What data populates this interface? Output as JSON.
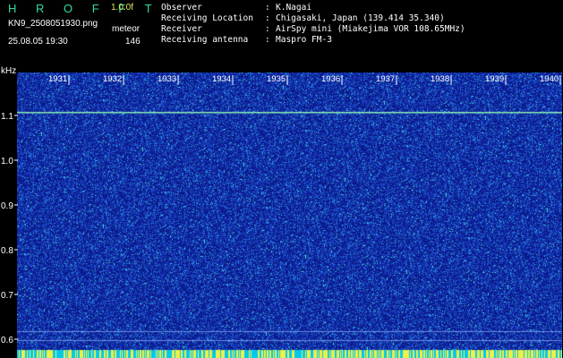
{
  "header": {
    "app_name": "H R O F F T",
    "version": "1.0.0f",
    "filename": "KN9_2508051930.png",
    "meteor_label": "meteor",
    "datetime": "25.08.05 19:30",
    "meteor_count": "146"
  },
  "info": [
    {
      "key": "Observer",
      "sep": ":",
      "value": "K.Nagai"
    },
    {
      "key": "Receiving Location",
      "sep": ":",
      "value": "Chigasaki, Japan (139.414 35.340)"
    },
    {
      "key": "Receiver",
      "sep": ":",
      "value": "AirSpy mini (Miakejima VOR 108.65MHz)"
    },
    {
      "key": "Receiving antenna",
      "sep": ":",
      "value": "Maspro FM-3"
    }
  ],
  "spectrogram": {
    "y_unit": "kHz",
    "y_ticks": [
      "1.1",
      "1.0",
      "0.9",
      "0.8",
      "0.7",
      "0.6"
    ],
    "minute_labels": [
      "1931",
      "1932",
      "1933",
      "1934",
      "1935",
      "1936",
      "1937",
      "1938",
      "1939",
      "1940"
    ],
    "colors": {
      "background": "#0b1a8c",
      "noise_low": "#1e50d2",
      "noise_mid": "#2aa0e6",
      "noise_high": "#4ae6d2",
      "carrier_line": "#8cf0b4",
      "bottom_strip_a": "#f0f046",
      "bottom_strip_b": "#00c8f0"
    }
  }
}
